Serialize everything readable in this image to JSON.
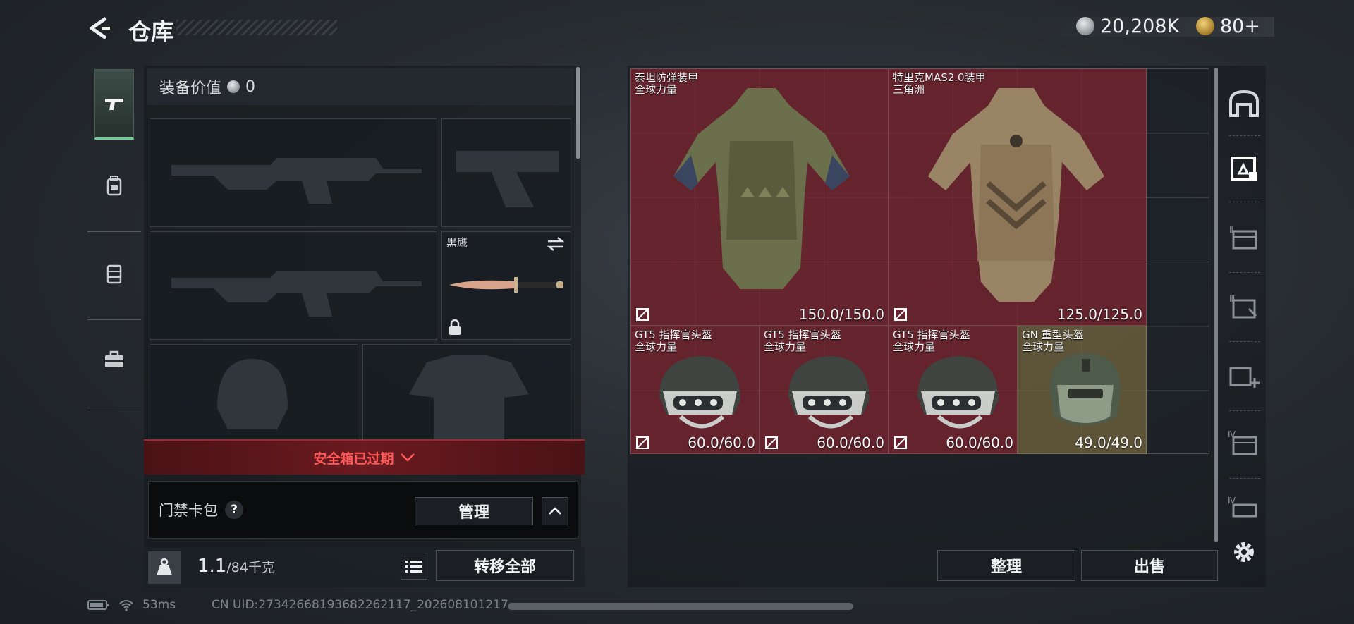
{
  "header": {
    "title": "仓库",
    "currency_silver": "20,208K",
    "currency_gold": "80+"
  },
  "tabs": [
    {
      "name": "weapon",
      "icon": "pistol-icon",
      "active": true
    },
    {
      "name": "supplies",
      "icon": "backpack-icon",
      "active": false
    },
    {
      "name": "rig",
      "icon": "rig-icon",
      "active": false
    },
    {
      "name": "toolbox",
      "icon": "toolbox-icon",
      "active": false
    }
  ],
  "equipment": {
    "value_label": "装备价值",
    "value": "0",
    "melee_label": "黑鹰",
    "safe_box_expired": "安全箱已过期",
    "card_bag_label": "门禁卡包",
    "help_glyph": "?",
    "manage_label": "管理",
    "weight_value": "1.1",
    "weight_max": "/84千克",
    "transfer_all_label": "转移全部"
  },
  "storage": {
    "items": [
      {
        "name": "泰坦防弹装甲",
        "sub": "全球力量",
        "durability": "150.0/150.0"
      },
      {
        "name": "特里克MAS2.0装甲",
        "sub": "三角洲",
        "durability": "125.0/125.0"
      },
      {
        "name": "GT5 指挥官头盔",
        "sub": "全球力量",
        "durability": "60.0/60.0"
      },
      {
        "name": "GT5 指挥官头盔",
        "sub": "全球力量",
        "durability": "60.0/60.0"
      },
      {
        "name": "GT5 指挥官头盔",
        "sub": "全球力量",
        "durability": "60.0/60.0"
      },
      {
        "name": "GN 重型头盔",
        "sub": "全球力量",
        "durability": "49.0/49.0"
      }
    ],
    "sort_label": "整理",
    "sell_label": "出售"
  },
  "rail": {
    "icons": [
      "safehouse-icon",
      "storage-active-icon",
      "storage-ii-icon",
      "storage-iii-icon",
      "storage-add-icon",
      "storage-iv-icon",
      "storage-iv-b-icon"
    ],
    "labels": [
      "Ⅱ",
      "Ⅲ",
      "Ⅳ",
      "Ⅳ"
    ]
  },
  "status_bar": {
    "ping": "53ms",
    "uid": "CN UID:2734266819368226211​7_202608101217"
  },
  "colors": {
    "accent_green": "#6fcf97",
    "warning_red": "#ff5a5a",
    "item_red": "#78242f",
    "item_gold": "#766840"
  }
}
